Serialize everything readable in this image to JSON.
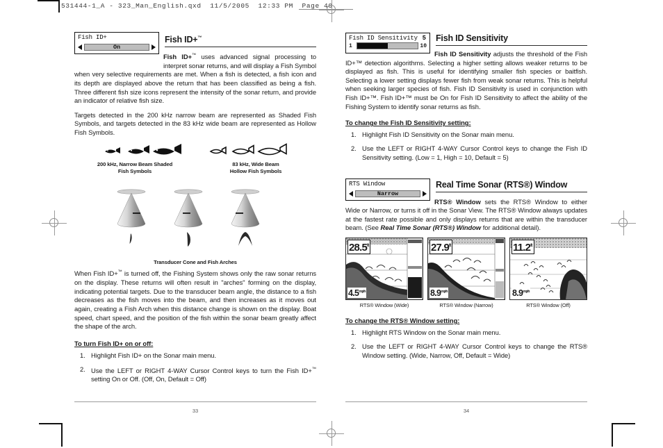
{
  "print_header": "531444-1_A - 323_Man_English.qxd  11/5/2005  12:33 PM  Page 40",
  "left_page": {
    "page_number": "33",
    "section": {
      "title": "Fish ID+",
      "title_tm": "™"
    },
    "widget": {
      "label": "Fish ID+",
      "value": "On",
      "arrow_left": "left-arrow",
      "arrow_right": "right-arrow"
    },
    "paragraphs": [
      {
        "lead": "Fish ID+",
        "lead_tm": "™",
        "text": " uses advanced signal processing to interpret sonar returns, and will display a Fish Symbol when very selective requirements are met. When a fish is detected, a fish icon and its depth are displayed above the return that has been classified as being a fish.  Three different fish size icons represent the intensity of the sonar return, and provide an indicator of relative fish size."
      },
      {
        "text": "Targets detected in the 200 kHz narrow beam are represented as Shaded Fish Symbols, and targets detected in the 83 kHz wide beam are represented as Hollow Fish Symbols."
      }
    ],
    "fish_figure": {
      "left_caption_line1": "200 kHz, Narrow Beam Shaded",
      "left_caption_line2": "Fish Symbols",
      "right_caption_line1": "83 kHz, Wide Beam",
      "right_caption_line2": "Hollow Fish Symbols"
    },
    "cone_figure": {
      "caption": "Transducer Cone and Fish Arches"
    },
    "paragraph_after_figure": {
      "pre": "When Fish ID+",
      "tm": "™",
      "text": " is turned off, the Fishing System shows only the raw sonar returns on the display. These returns will often result in \"arches\" forming on the display, indicating potential targets. Due to the transducer beam angle, the distance to a fish decreases as the fish moves into the beam, and then increases as it moves out again, creating a Fish Arch when this distance change is shown on the display.  Boat speed, chart speed, and the position of the fish within the sonar beam greatly affect the shape of the arch."
    },
    "procedure": {
      "heading": "To turn Fish ID+ on or off:",
      "steps": [
        {
          "num": "1.",
          "text": "Highlight Fish ID+ on the Sonar main menu."
        },
        {
          "num": "2.",
          "pre": "Use the LEFT or RIGHT 4-WAY Cursor Control keys to turn the Fish ID+",
          "tm": "™",
          "post": " setting On or Off. (Off, On, Default = Off)"
        }
      ]
    }
  },
  "right_page": {
    "page_number": "34",
    "section1": {
      "title": "Fish ID Sensitivity",
      "widget": {
        "label": "Fish ID Sensitivity",
        "value": "5",
        "min": "1",
        "max": "10",
        "fill_percent": 50
      },
      "paragraph": {
        "lead": "Fish ID Sensitivity",
        "text": " adjusts the threshold of the Fish ID+™ detection algorithms.  Selecting a higher setting allows weaker returns to be displayed as fish.  This is useful for identifying smaller fish species or baitfish. Selecting a lower setting displays fewer fish from weak sonar returns. This is helpful when seeking larger species of fish. Fish ID Sensitivity is used in conjunction with Fish ID+™. Fish ID+™ must be On for Fish ID Sensitivity to affect the ability of the Fishing System to identify sonar returns as fish."
      },
      "procedure": {
        "heading": "To change the Fish ID Sensitivity setting:",
        "steps": [
          {
            "num": "1.",
            "text": "Highlight Fish ID Sensitivity on the Sonar main menu."
          },
          {
            "num": "2.",
            "text": "Use the LEFT or RIGHT 4-WAY Cursor Control keys to change the Fish ID Sensitivity setting. (Low = 1, High = 10, Default = 5)"
          }
        ]
      }
    },
    "section2": {
      "title": "Real Time Sonar (RTS®) Window",
      "widget": {
        "label": "RTS Window",
        "value": "Narrow",
        "arrow_left": "left-arrow",
        "arrow_right": "right-arrow"
      },
      "paragraph": {
        "lead": "RTS® Window",
        "text": " sets the RTS® Window to either Wide or Narrow, or turns it off in the Sonar View. The RTS® Window always updates at the fastest rate possible and only displays returns that are within the transducer beam. (See ",
        "italic_ref": "Real Time Sonar (RTS®) Window",
        "text_end": " for additional detail)."
      },
      "screenshots": [
        {
          "depth": "28.5",
          "depth_unit": "ft",
          "bottom": "4.5",
          "bottom_unit": "mph",
          "caption": "RTS® Window (Wide)"
        },
        {
          "depth": "27.9",
          "depth_unit": "ft",
          "bottom": "8.9",
          "bottom_unit": "mph",
          "caption": "RTS® Window (Narrow)"
        },
        {
          "depth": "11.2",
          "depth_unit": "ft",
          "bottom": "8.9",
          "bottom_unit": "mph",
          "caption": "RTS® Window (Off)"
        }
      ],
      "procedure": {
        "heading": "To change the RTS® Window setting:",
        "steps": [
          {
            "num": "1.",
            "text": "Highlight RTS Window on the Sonar main menu."
          },
          {
            "num": "2.",
            "text": "Use the LEFT or RIGHT 4-WAY Cursor Control keys to change the RTS® Window setting. (Wide, Narrow, Off, Default = Wide)"
          }
        ]
      }
    }
  }
}
